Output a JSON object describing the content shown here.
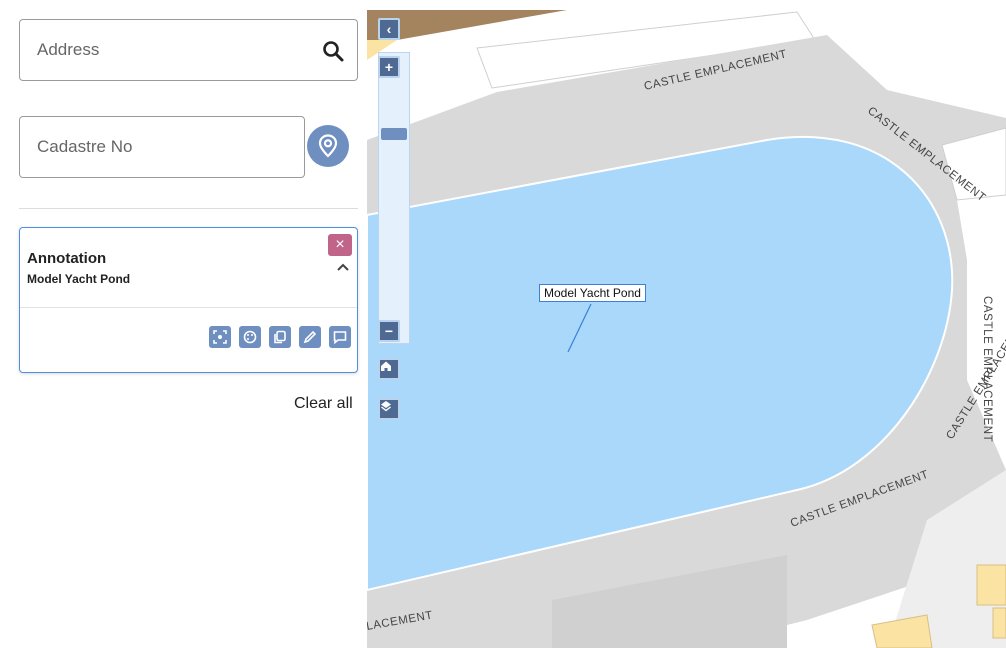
{
  "search": {
    "address_placeholder": "Address",
    "cadastre_placeholder": "Cadastre No"
  },
  "card": {
    "title": "Annotation",
    "subtitle": "Model Yacht Pond",
    "close_label": "×",
    "tools": [
      "zoom-to-icon",
      "palette-icon",
      "copy-icon",
      "edit-icon",
      "comment-icon"
    ]
  },
  "clear_all": "Clear all",
  "map": {
    "annotation_label": "Model Yacht Pond",
    "road_labels": [
      "CASTLE EMPLACEMENT",
      "CASTLE EMPLACEMENT",
      "CASTLE EMPLACEMENT",
      "CASTLE EMPLACEMENT",
      "CASTLE EMPLACEMENT",
      "LACEMENT"
    ],
    "controls": {
      "collapse": "‹",
      "zoom_in": "+",
      "zoom_out": "−"
    },
    "colors": {
      "water": "#a9d8fb",
      "road": "#d9d9d9",
      "building": "#fbe3a4",
      "accent": "#6e8fc0"
    }
  }
}
